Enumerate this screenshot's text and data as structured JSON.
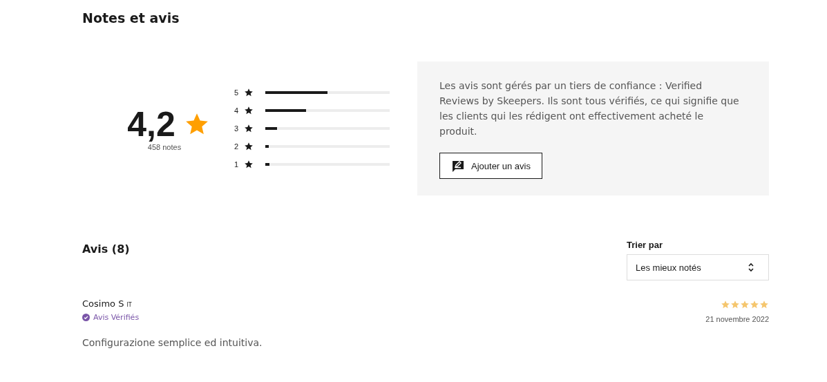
{
  "title": "Notes et avis",
  "summary": {
    "score": "4,2",
    "count": "458 notes",
    "distribution": [
      {
        "label": "5",
        "level": 0.5
      },
      {
        "label": "4",
        "level": 0.33
      },
      {
        "label": "3",
        "level": 0.095
      },
      {
        "label": "2",
        "level": 0.03
      },
      {
        "label": "1",
        "level": 0.035
      }
    ]
  },
  "info": {
    "text": "Les avis sont gérés par un tiers de confiance : Verified Reviews by Skeepers. Ils sont tous vérifiés, ce qui signifie que les clients qui les rédigent ont effectivement acheté le produit.",
    "button": "Ajouter un avis"
  },
  "reviews_heading": "Avis (8)",
  "sort": {
    "label": "Trier par",
    "value": "Les mieux notés"
  },
  "reviews": [
    {
      "author": "Cosimo S",
      "country": "IT",
      "verified": "Avis Vérifiés",
      "stars": 5,
      "date": "21 novembre 2022",
      "text": "Configurazione semplice ed intuitiva."
    }
  ]
}
